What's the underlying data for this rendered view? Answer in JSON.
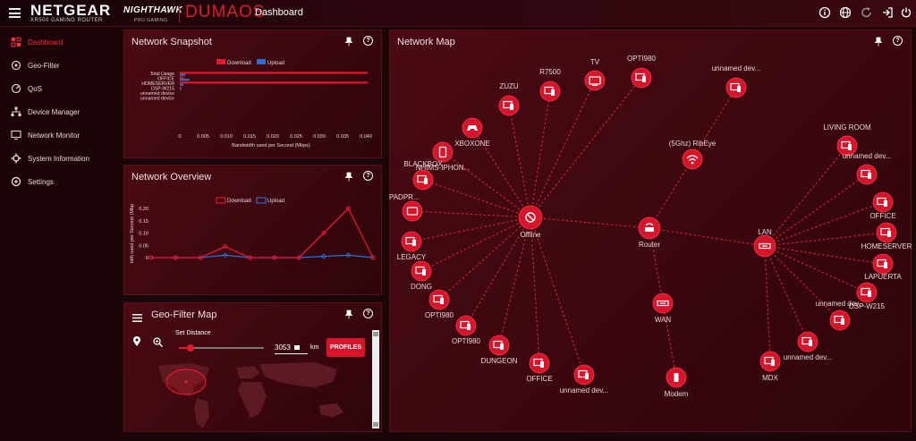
{
  "header": {
    "brand": "NETGEAR",
    "brand_sub": "XR500 GAMING ROUTER",
    "nighthawk": "NIGHTHAWK",
    "nighthawk_sub": "PRO GAMING",
    "os": "DUMAOS",
    "page": "Dashboard",
    "icons": [
      "info-icon",
      "globe-icon",
      "refresh-icon",
      "logout-icon",
      "power-icon"
    ]
  },
  "sidebar": {
    "items": [
      {
        "label": "Dashboard",
        "icon": "dashboard-icon",
        "active": true
      },
      {
        "label": "Geo-Filter",
        "icon": "geo-filter-icon",
        "active": false
      },
      {
        "label": "QoS",
        "icon": "qos-icon",
        "active": false
      },
      {
        "label": "Device Manager",
        "icon": "device-manager-icon",
        "active": false
      },
      {
        "label": "Network Monitor",
        "icon": "network-monitor-icon",
        "active": false
      },
      {
        "label": "System Information",
        "icon": "system-info-icon",
        "active": false
      },
      {
        "label": "Settings",
        "icon": "settings-icon",
        "active": false
      }
    ]
  },
  "snapshot": {
    "title": "Network Snapshot",
    "legend": [
      "Download",
      "Upload"
    ],
    "rows": [
      "Total Usage",
      "OFFICE",
      "HOMESERVER",
      "DSP-W215",
      "unnamed device",
      "unnamed device"
    ],
    "download": [
      0.041,
      0.0008,
      0.041,
      0.0003,
      0,
      0
    ],
    "upload": [
      0.0012,
      0.0021,
      0.0008,
      0.0003,
      0,
      0
    ],
    "ticks": [
      "0",
      "0.005",
      "0.010",
      "0.015",
      "0.020",
      "0.025",
      "0.030",
      "0.035",
      "0.040"
    ],
    "xlabel": "Bandwidth used per Second (Mbps)"
  },
  "overview": {
    "title": "Network Overview",
    "legend": [
      "Download",
      "Upload"
    ],
    "ylabel": "idth used per Second (Mbp",
    "yticks": [
      "0",
      "0.05",
      "0.10",
      "0.15",
      "0.20"
    ],
    "download": [
      0,
      0,
      0,
      0.045,
      0,
      0,
      0,
      0.1,
      0.2,
      0
    ],
    "upload": [
      0,
      0,
      0,
      0.01,
      0,
      0,
      0,
      0.005,
      0.01,
      0
    ]
  },
  "geo": {
    "title": "Geo-Filter Map",
    "set_distance": "Set Distance",
    "distance": "3053",
    "unit": "km",
    "profiles": "PROFILES"
  },
  "netmap": {
    "title": "Network Map",
    "nodes": [
      {
        "id": "offline",
        "label": "Offline",
        "icon": "offline-icon"
      },
      {
        "id": "router",
        "label": "Router",
        "icon": "router-icon"
      },
      {
        "id": "lan",
        "label": "LAN",
        "icon": "lan-icon"
      },
      {
        "id": "wan",
        "label": "WAN",
        "icon": "wan-icon"
      },
      {
        "id": "modem",
        "label": "Modem",
        "icon": "modem-icon"
      },
      {
        "id": "ribeye",
        "label": "(5Ghz) RibEye",
        "icon": "wifi-icon"
      },
      {
        "id": "unnamed-top",
        "label": "unnamed dev...",
        "icon": "device-icon"
      },
      {
        "id": "opti980-top",
        "label": "OPTI980",
        "icon": "device-icon"
      },
      {
        "id": "tv",
        "label": "TV",
        "icon": "tv-icon"
      },
      {
        "id": "r7500",
        "label": "R7500",
        "icon": "device-icon"
      },
      {
        "id": "zuzu",
        "label": "ZUZU",
        "icon": "device-icon"
      },
      {
        "id": "xboxone",
        "label": "XBOXONE",
        "icon": "gamepad-icon"
      },
      {
        "id": "nhims",
        "label": "NHIMS-IPHON...",
        "icon": "phone-icon"
      },
      {
        "id": "blackbox",
        "label": "BLACKBOX",
        "icon": "device-icon"
      },
      {
        "id": "dongsip",
        "label": "DONGSIPADPR...",
        "icon": "tablet-icon"
      },
      {
        "id": "legacy",
        "label": "LEGACY",
        "icon": "device-icon"
      },
      {
        "id": "dong",
        "label": "DONG",
        "icon": "device-icon"
      },
      {
        "id": "opti980-a",
        "label": "OPTI980",
        "icon": "device-icon"
      },
      {
        "id": "opti980-b",
        "label": "OPTI980",
        "icon": "device-icon"
      },
      {
        "id": "dungeon",
        "label": "DUNGEON",
        "icon": "device-icon"
      },
      {
        "id": "office-off",
        "label": "OFFICE",
        "icon": "device-icon"
      },
      {
        "id": "unnamed-bottom",
        "label": "unnamed dev...",
        "icon": "device-icon"
      },
      {
        "id": "living",
        "label": "LIVING ROOM",
        "icon": "device-icon"
      },
      {
        "id": "unnamed-lan1",
        "label": "unnamed dev...",
        "icon": "device-icon"
      },
      {
        "id": "office-lan",
        "label": "OFFICE",
        "icon": "device-icon"
      },
      {
        "id": "homeserver",
        "label": "HOMESERVER",
        "icon": "device-icon"
      },
      {
        "id": "lapuerta",
        "label": "LAPUERTA",
        "icon": "device-icon"
      },
      {
        "id": "dsp",
        "label": "DSP-W215",
        "icon": "device-icon"
      },
      {
        "id": "unnamed-lan2",
        "label": "unnamed dev...",
        "icon": "device-icon"
      },
      {
        "id": "unnamed-lan3",
        "label": "unnamed dev...",
        "icon": "device-icon"
      },
      {
        "id": "mdx",
        "label": "MDX",
        "icon": "device-icon"
      }
    ]
  }
}
